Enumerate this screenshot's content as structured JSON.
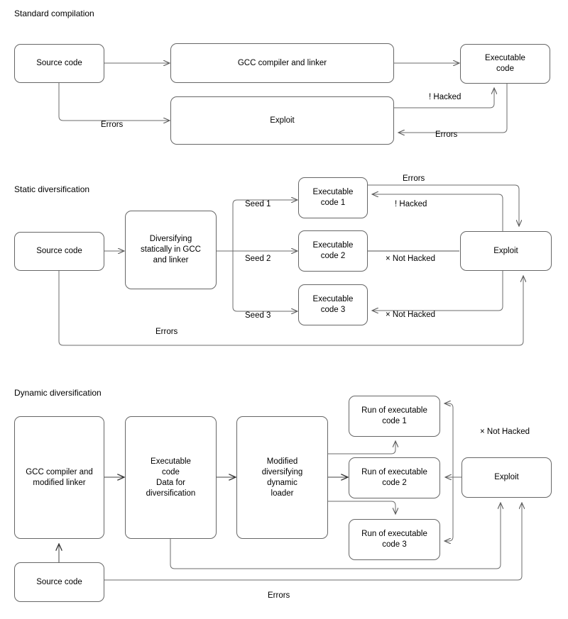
{
  "diagram": {
    "title_bar": null,
    "sections": [
      {
        "id": "standard",
        "title": "Standard compilation",
        "nodes": [
          {
            "id": "s1-source",
            "label": "Source code"
          },
          {
            "id": "s1-gcc",
            "label": "GCC compiler and linker"
          },
          {
            "id": "s1-exec",
            "label_line1": "Executable",
            "label_line2": "code"
          },
          {
            "id": "s1-exploit",
            "label": "Exploit"
          }
        ],
        "edge_labels": [
          {
            "id": "s1-errors-left",
            "text": "Errors"
          },
          {
            "id": "s1-hacked",
            "text": "! Hacked"
          },
          {
            "id": "s1-errors-right",
            "text": "Errors"
          }
        ]
      },
      {
        "id": "static",
        "title": "Static diversification",
        "nodes": [
          {
            "id": "s2-source",
            "label": "Source code"
          },
          {
            "id": "s2-div",
            "label_line1": "Diversifying",
            "label_line2": "statically in GCC",
            "label_line3": "and linker"
          },
          {
            "id": "s2-exec1",
            "label_line1": "Executable",
            "label_line2": "code 1"
          },
          {
            "id": "s2-exec2",
            "label_line1": "Executable",
            "label_line2": "code 2"
          },
          {
            "id": "s2-exec3",
            "label_line1": "Executable",
            "label_line2": "code 3"
          },
          {
            "id": "s2-exploit",
            "label": "Exploit"
          }
        ],
        "edge_labels": [
          {
            "id": "s2-seed1",
            "text": "Seed 1"
          },
          {
            "id": "s2-seed2",
            "text": "Seed 2"
          },
          {
            "id": "s2-seed3",
            "text": "Seed 3"
          },
          {
            "id": "s2-errors-top",
            "text": "Errors"
          },
          {
            "id": "s2-hacked",
            "text": "! Hacked"
          },
          {
            "id": "s2-nothacked2",
            "text": "× Not Hacked"
          },
          {
            "id": "s2-nothacked3",
            "text": "× Not Hacked"
          },
          {
            "id": "s2-errors-bottom",
            "text": "Errors"
          }
        ]
      },
      {
        "id": "dynamic",
        "title": "Dynamic diversification",
        "nodes": [
          {
            "id": "s3-gcc",
            "label_line1": "GCC compiler and",
            "label_line2": "modified linker"
          },
          {
            "id": "s3-execdata",
            "label_line1": "Executable",
            "label_line2": "code",
            "label_line3": "Data for",
            "label_line4": "diversification"
          },
          {
            "id": "s3-loader",
            "label_line1": "Modified",
            "label_line2": "diversifying",
            "label_line3": "dynamic",
            "label_line4": "loader"
          },
          {
            "id": "s3-run1",
            "label_line1": "Run of executable",
            "label_line2": "code 1"
          },
          {
            "id": "s3-run2",
            "label_line1": "Run of executable",
            "label_line2": "code 2"
          },
          {
            "id": "s3-run3",
            "label_line1": "Run of executable",
            "label_line2": "code 3"
          },
          {
            "id": "s3-exploit",
            "label": "Exploit"
          },
          {
            "id": "s3-source",
            "label": "Source code"
          }
        ],
        "edge_labels": [
          {
            "id": "s3-nothacked",
            "text": "× Not Hacked"
          },
          {
            "id": "s3-errors",
            "text": "Errors"
          }
        ]
      }
    ],
    "colors": {
      "stroke": "#666666",
      "stroke_dark": "#4a4a4a",
      "text": "#000000",
      "background": "#ffffff"
    }
  }
}
